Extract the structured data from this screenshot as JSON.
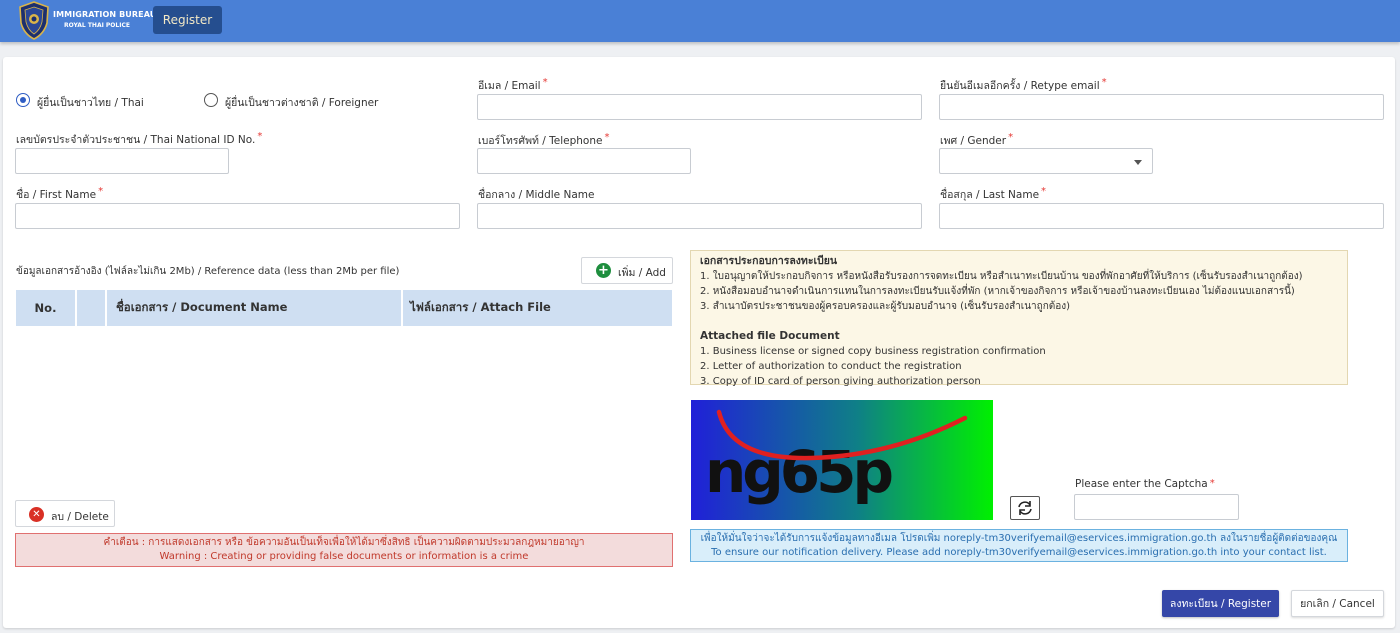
{
  "header": {
    "brand_line1": "IMMIGRATION BUREAU",
    "brand_line2": "ROYAL THAI POLICE",
    "register_tab": "Register",
    "bar_color": "#4a80d6"
  },
  "form": {
    "nationality": {
      "thai_label": "ผู้ยื่นเป็นชาวไทย / Thai",
      "foreigner_label": "ผู้ยื่นเป็นชาวต่างชาติ / Foreigner",
      "selected": "thai"
    },
    "email_label": "อีเมล / Email",
    "retype_email_label": "ยืนยันอีเมลอีกครั้ง / Retype email",
    "national_id_label": "เลขบัตรประจำตัวประชาชน / Thai National ID No.",
    "telephone_label": "เบอร์โทรศัพท์ / Telephone",
    "gender_label": "เพศ / Gender",
    "first_name_label": "ชื่อ / First Name",
    "middle_name_label": "ชื่อกลาง / Middle Name",
    "last_name_label": "ชื่อสกุล / Last Name",
    "required_mark": "*"
  },
  "documents": {
    "section_label": "ข้อมูลเอกสารอ้างอิง (ไฟล์ละไม่เกิน 2Mb) / Reference data (less than 2Mb per file)",
    "add_button": "เพิ่ม / Add",
    "columns": [
      "No.",
      "",
      "ชื่อเอกสาร / Document Name",
      "ไฟล์เอกสาร / Attach File"
    ],
    "delete_button": "ลบ / Delete",
    "warning_th": "คำเตือน : การแสดงเอกสาร หรือ ข้อความอันเป็นเท็จเพื่อให้ได้มาซึ่งสิทธิ เป็นความผิดตามประมวลกฎหมายอาญา",
    "warning_en": "Warning : Creating or providing false documents or information is a crime"
  },
  "requirements": {
    "title_th": "เอกสารประกอบการลงทะเบียน",
    "items_th": [
      "1. ใบอนุญาตให้ประกอบกิจการ หรือหนังสือรับรองการจดทะเบียน หรือสำเนาทะเบียนบ้าน ของที่พักอาศัยที่ให้บริการ (เซ็นรับรองสำเนาถูกต้อง)",
      "2. หนังสือมอบอำนาจดำเนินการแทนในการลงทะเบียนรับแจ้งที่พัก (หากเจ้าของกิจการ หรือเจ้าของบ้านลงทะเบียนเอง ไม่ต้องแนบเอกสารนี้)",
      "3. สำเนาบัตรประชาชนของผู้ครอบครองและผู้รับมอบอำนาจ (เซ็นรับรองสำเนาถูกต้อง)"
    ],
    "title_en": "Attached file Document",
    "items_en": [
      "1. Business license or signed copy business registration confirmation",
      "2. Letter of authorization to conduct the registration",
      "3. Copy of ID card of person giving authorization person"
    ]
  },
  "captcha": {
    "text": "ng65p",
    "input_label": "Please enter the Captcha",
    "refresh_icon": "refresh-icon"
  },
  "notice": {
    "line_th": "เพื่อให้มั่นใจว่าจะได้รับการแจ้งข้อมูลทางอีเมล โปรดเพิ่ม noreply-tm30verifyemail@eservices.immigration.go.th ลงในรายชื่อผู้ติดต่อของคุณ",
    "line_en": "To ensure our notification delivery. Please add noreply-tm30verifyemail@eservices.immigration.go.th into your contact list."
  },
  "actions": {
    "register": "ลงทะเบียน / Register",
    "cancel": "ยกเลิก / Cancel",
    "primary_color": "#3547a8"
  }
}
